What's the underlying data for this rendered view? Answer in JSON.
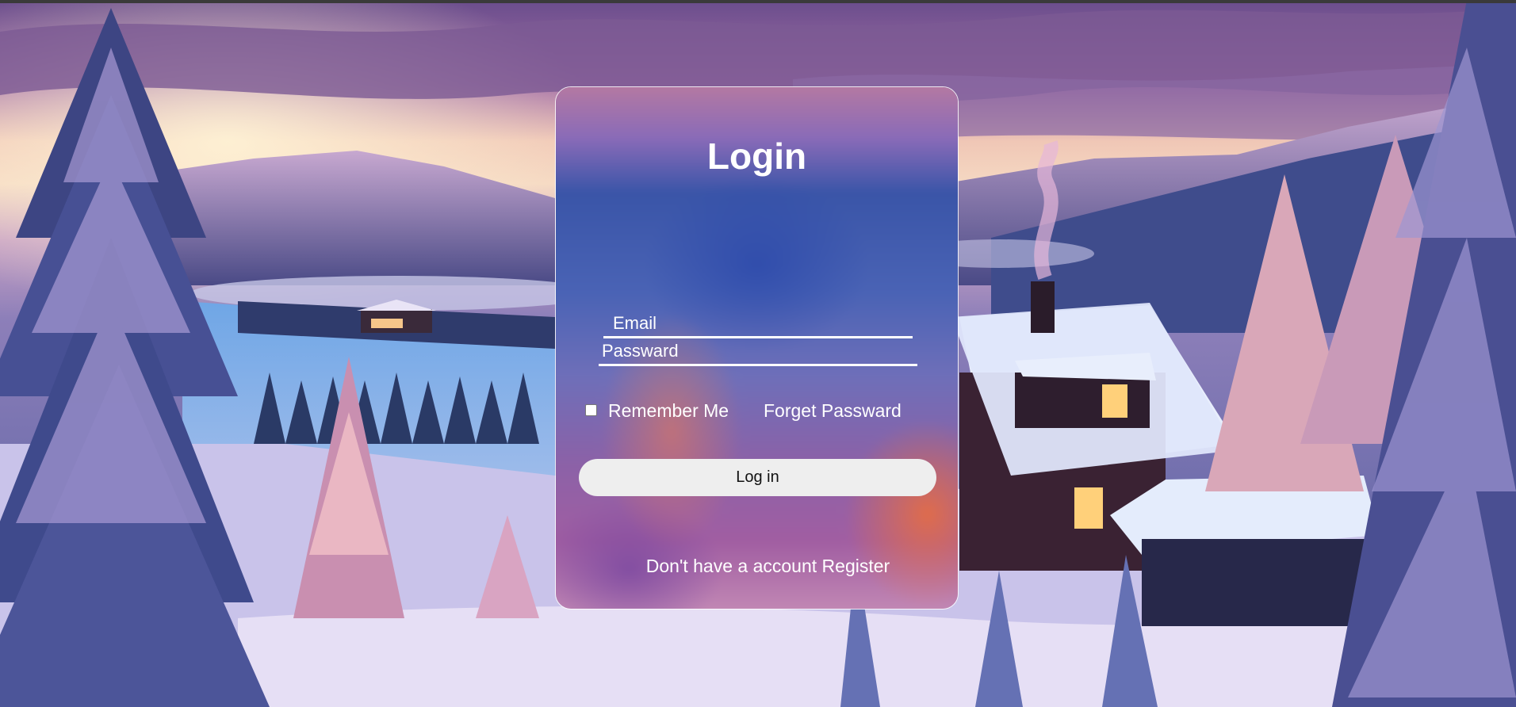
{
  "login": {
    "title": "Login",
    "email_placeholder": "Email",
    "password_placeholder": "Passward",
    "remember_label": "Remember Me",
    "forget_link": "Forget Passward",
    "login_button": "Log in",
    "register_prompt": "Don't have a account",
    "register_link": "Register"
  },
  "colors": {
    "text": "#ffffff",
    "button_bg": "#eeeeee",
    "button_text": "#111111",
    "card_border": "#ffffff"
  }
}
